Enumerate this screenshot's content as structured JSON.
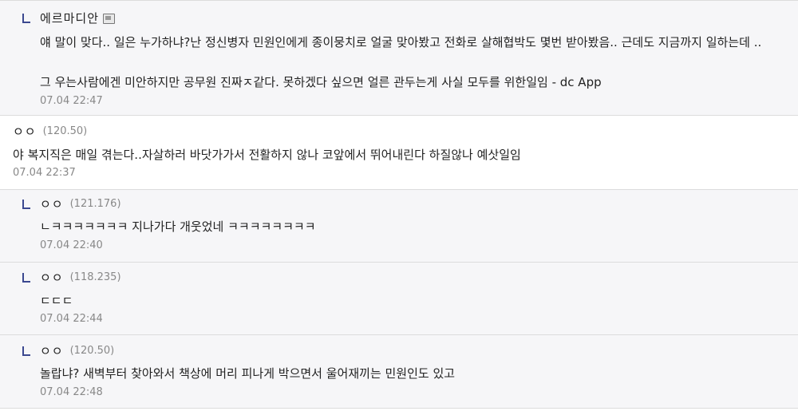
{
  "comments": [
    {
      "nick": "에르마디안",
      "lines": [
        "얘 말이 맞다.. 일은 누가하냐?난 정신병자 민원인에게 종이뭉치로 얼굴 맞아봤고 전화로 살해협박도 몇번 받아봤음.. 근데도 지금까지 일하는데 ..",
        "그 우는사람에겐 미안하지만 공무원 진짜ㅈ같다. 못하겠다 싶으면 얼른 관두는게 사실 모두를 위한일임 - dc App"
      ],
      "date": "07.04 22:47"
    },
    {
      "nick": "ㅇㅇ",
      "ip": "(120.50)",
      "text": "야 복지직은 매일 겪는다..자살하러 바닷가가서 전활하지 않나 코앞에서 뛰어내린다 하질않나 예삿일임",
      "date": "07.04 22:37"
    },
    {
      "nick": "ㅇㅇ",
      "ip": "(121.176)",
      "text": "ㄴㅋㅋㅋㅋㅋㅋㅋ 지나가다 개웃었네 ㅋㅋㅋㅋㅋㅋㅋㅋ",
      "date": "07.04 22:40"
    },
    {
      "nick": "ㅇㅇ",
      "ip": "(118.235)",
      "text": "ㄷㄷㄷ",
      "date": "07.04 22:44"
    },
    {
      "nick": "ㅇㅇ",
      "ip": "(120.50)",
      "text": "놀랍냐? 새벽부터 찾아와서 책상에 머리 피나게 박으면서 울어재끼는 민원인도 있고",
      "date": "07.04 22:48"
    }
  ]
}
